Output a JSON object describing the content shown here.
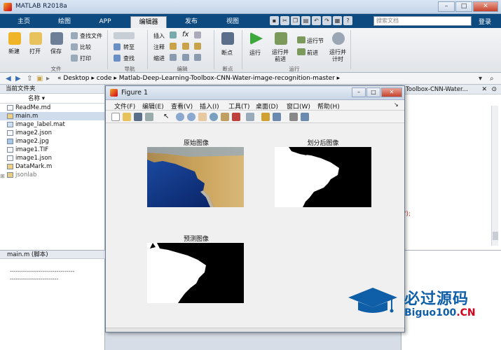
{
  "app": {
    "title": "MATLAB R2018a",
    "login": "登录",
    "search_placeholder": "搜索文档"
  },
  "tabs": [
    "主页",
    "绘图",
    "APP",
    "编辑器",
    "发布",
    "视图"
  ],
  "active_tab": "编辑器",
  "ribbon": {
    "file": {
      "new": "新建",
      "open": "打开",
      "save": "保存",
      "find_files": "查找文件",
      "compare": "比较",
      "print": "打印",
      "group": "文件"
    },
    "nav": {
      "goto": "转至",
      "find": "查找",
      "group": "导航"
    },
    "edit": {
      "insert": "插入",
      "comment": "注释",
      "indent": "缩进",
      "group": "编辑"
    },
    "breakpoints": {
      "label": "断点",
      "group": "断点"
    },
    "run": {
      "run": "运行",
      "run_advance": "运行并\n前进",
      "run_section": "运行节",
      "advance": "前进",
      "run_time": "运行并\n计时",
      "group": "运行"
    }
  },
  "address": {
    "path": [
      "«",
      "Desktop",
      "code",
      "Matlab-Deep-Learning-Toolbox-CNN-Water-image-recognition-master"
    ]
  },
  "files_panel": {
    "title": "当前文件夹",
    "column": "名称",
    "files": [
      "ReadMe.md",
      "main.m",
      "image_label.mat",
      "image2.json",
      "image2.jpg",
      "image1.TIF",
      "image1.json",
      "DataMark.m",
      "jsonlab"
    ],
    "selected": "main.m"
  },
  "details": {
    "title": "main.m  (脚本)",
    "lines": [
      "--------------------------------",
      "------------------------"
    ]
  },
  "editor": {
    "tab_title": "Toolbox-CNN-Water...",
    "code_fragment": "');"
  },
  "figure": {
    "title": "Figure 1",
    "menu": [
      "文件(F)",
      "编辑(E)",
      "查看(V)",
      "插入(I)",
      "工具(T)",
      "桌面(D)",
      "窗口(W)",
      "帮助(H)"
    ],
    "plots": [
      {
        "title": "原始图像"
      },
      {
        "title": "划分后图像"
      },
      {
        "title": "预测图像"
      }
    ]
  },
  "watermark": {
    "cn": "必过源码",
    "en_prefix": "Biguo100",
    "en_suffix": ".CN"
  },
  "colors": {
    "tabbar": "#0c4a80",
    "accent": "#0f5fa8",
    "sea": "#0a2a78",
    "land": "#c9a25a"
  }
}
